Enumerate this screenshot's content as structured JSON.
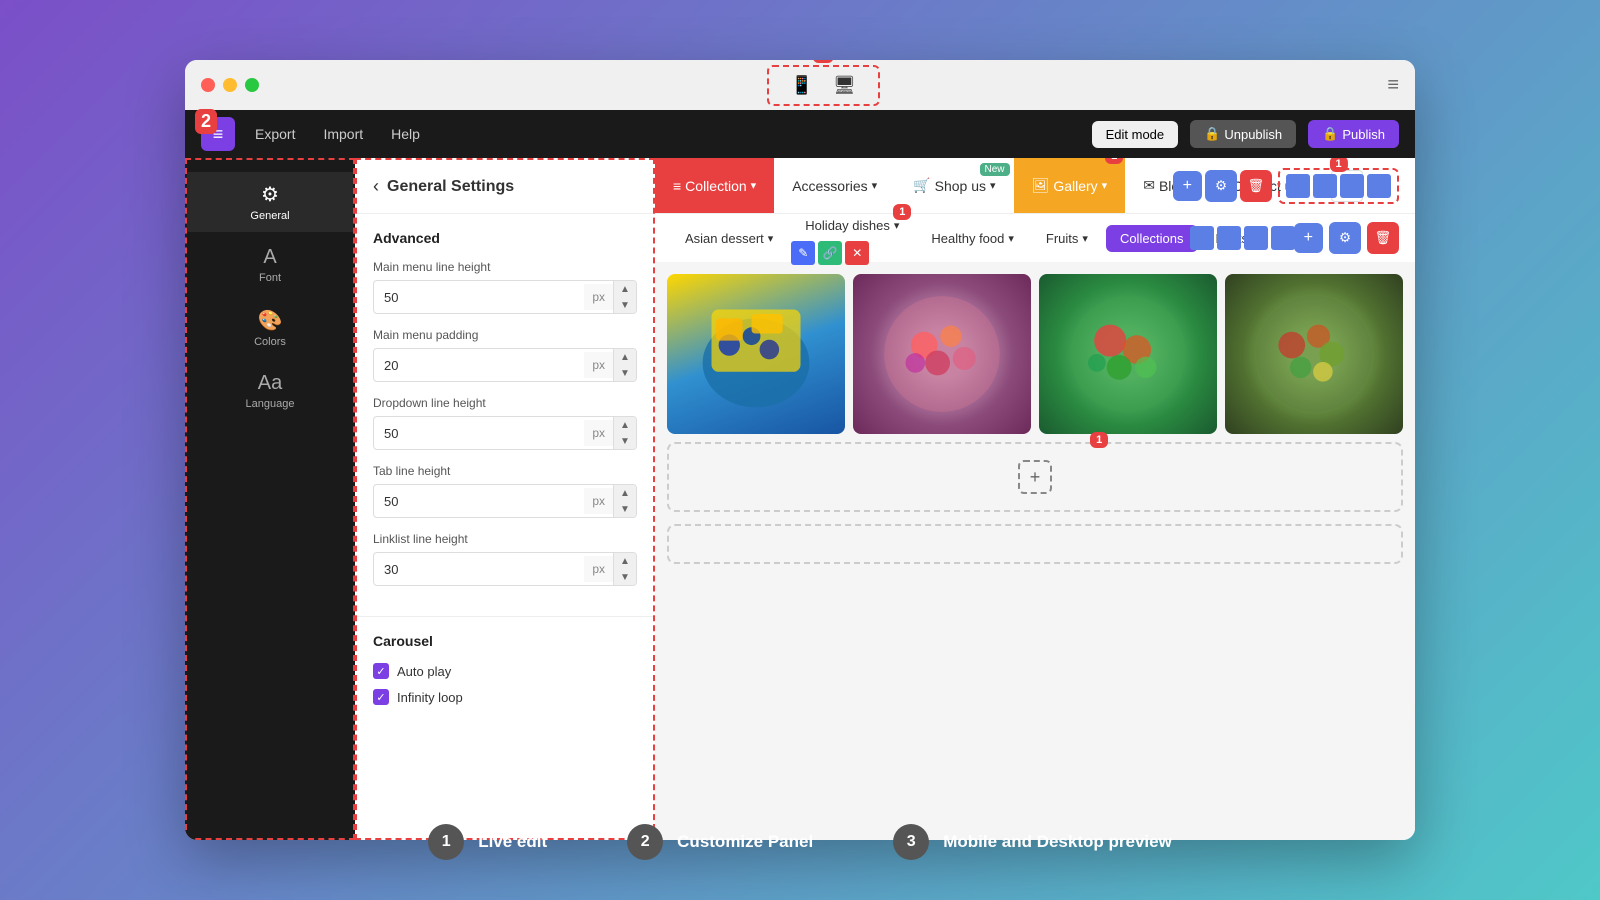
{
  "browser": {
    "traffic_lights": [
      "red",
      "yellow",
      "green"
    ],
    "hamburger": "≡"
  },
  "toolbar": {
    "export_label": "Export",
    "import_label": "Import",
    "help_label": "Help",
    "edit_mode_label": "Edit mode",
    "unpublish_label": "Unpublish",
    "publish_label": "Publish"
  },
  "sidebar": {
    "items": [
      {
        "id": "general",
        "label": "General",
        "icon": "⚙"
      },
      {
        "id": "font",
        "label": "Font",
        "icon": "A"
      },
      {
        "id": "colors",
        "label": "Colors",
        "icon": "🎨"
      },
      {
        "id": "language",
        "label": "Language",
        "icon": "Aa"
      }
    ]
  },
  "settings": {
    "back_label": "‹",
    "title": "General Settings",
    "advanced_title": "Advanced",
    "fields": [
      {
        "label": "Main menu line height",
        "value": "50",
        "unit": "px"
      },
      {
        "label": "Main menu padding",
        "value": "20",
        "unit": "px"
      },
      {
        "label": "Dropdown line height",
        "value": "50",
        "unit": "px"
      },
      {
        "label": "Tab line height",
        "value": "50",
        "unit": "px"
      },
      {
        "label": "Linklist line height",
        "value": "30",
        "unit": "px"
      }
    ],
    "carousel_title": "Carousel",
    "carousel_options": [
      {
        "label": "Auto play",
        "checked": true
      },
      {
        "label": "Infinity loop",
        "checked": true
      }
    ]
  },
  "sitenav": {
    "items": [
      {
        "label": "Collection",
        "active": true,
        "icon": "≡"
      },
      {
        "label": "Accessories",
        "has_arrow": true
      },
      {
        "label": "Shop us",
        "has_arrow": true
      },
      {
        "label": "Gallery",
        "active_orange": true,
        "has_arrow": true
      },
      {
        "label": "Blog",
        "has_arrow": true
      },
      {
        "label": "Contact us",
        "has_arrow": true
      }
    ],
    "new_badge": "New",
    "add_icon": "+"
  },
  "subnav": {
    "items": [
      {
        "label": "Asian dessert",
        "has_arrow": true
      },
      {
        "label": "Holiday dishes",
        "has_arrow": true
      },
      {
        "label": "Healthy food",
        "has_arrow": true,
        "active": false
      },
      {
        "label": "Fruits",
        "has_arrow": true
      },
      {
        "label": "Collections",
        "active": true
      },
      {
        "label": "Posts",
        "has_arrow": true
      }
    ],
    "add_icon": "+",
    "settings_icon": "⚙",
    "delete_icon": "🗑"
  },
  "gallery": {
    "images": [
      {
        "alt": "fruit bowl 1",
        "color_start": "#ffd700",
        "color_end": "#1a8fdc"
      },
      {
        "alt": "fruit bowl 2",
        "color_start": "#ff6b6b",
        "color_end": "#9b59b6"
      },
      {
        "alt": "fruit bowl 3",
        "color_start": "#2ecc71",
        "color_end": "#e74c3c"
      },
      {
        "alt": "fruit bowl 4",
        "color_start": "#27ae60",
        "color_end": "#c0392b"
      }
    ]
  },
  "badges": {
    "num1": "1",
    "num2": "2",
    "num3": "3"
  },
  "legend": {
    "items": [
      {
        "num": "1",
        "label": "Live edit"
      },
      {
        "num": "2",
        "label": "Customize Panel"
      },
      {
        "num": "3",
        "label": "Mobile and Desktop preview"
      }
    ]
  }
}
